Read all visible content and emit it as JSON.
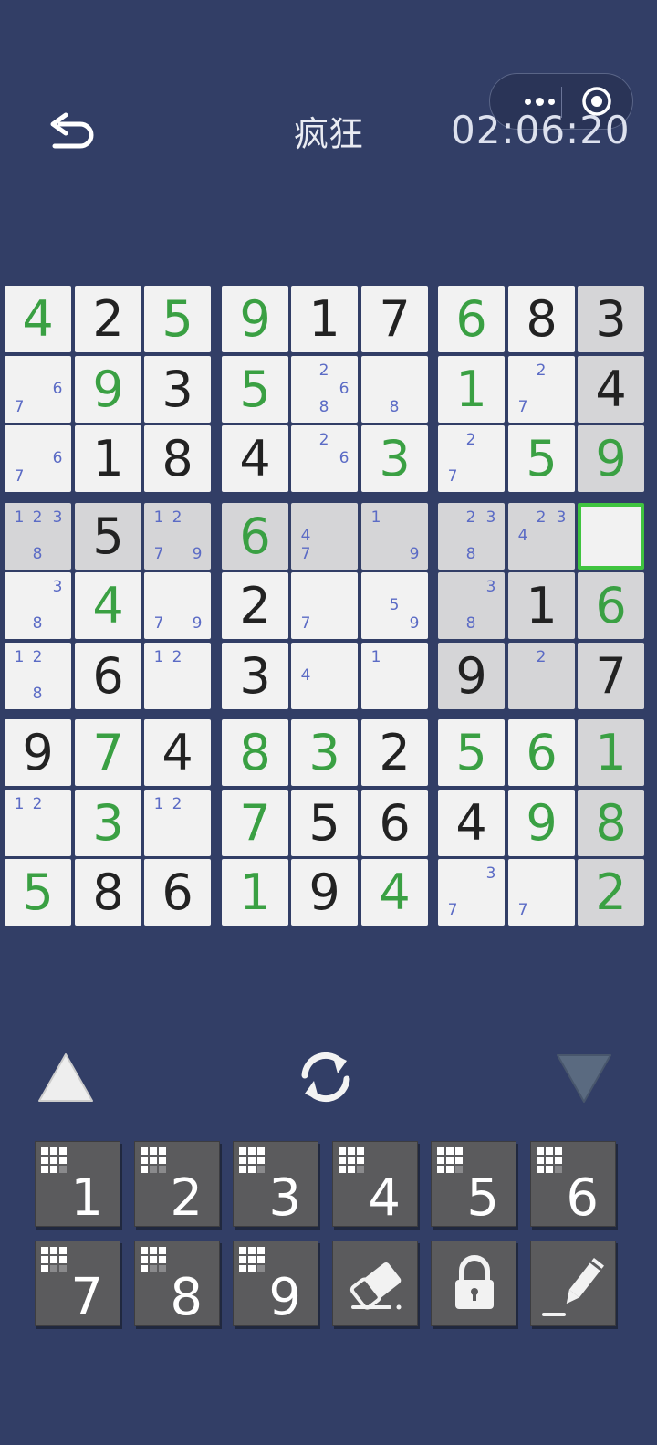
{
  "header": {
    "title": "疯狂",
    "timer": "02:06:20"
  },
  "colors": {
    "background": "#323e66",
    "cell": "#f2f2f2",
    "highlight": "#d5d5d7",
    "given_digit": "#222222",
    "user_digit": "#3aa043",
    "note_digit": "#5b6bc5",
    "selection_border": "#3fc43f",
    "key": "#5b5b5d"
  },
  "board": {
    "selected": {
      "row": 3,
      "col": 8
    },
    "highlighted": [
      [
        0,
        8
      ],
      [
        1,
        8
      ],
      [
        2,
        8
      ],
      [
        3,
        0
      ],
      [
        3,
        1
      ],
      [
        3,
        2
      ],
      [
        3,
        3
      ],
      [
        3,
        4
      ],
      [
        3,
        5
      ],
      [
        3,
        6
      ],
      [
        3,
        7
      ],
      [
        4,
        6
      ],
      [
        4,
        7
      ],
      [
        4,
        8
      ],
      [
        5,
        6
      ],
      [
        5,
        7
      ],
      [
        5,
        8
      ],
      [
        6,
        8
      ],
      [
        7,
        8
      ],
      [
        8,
        8
      ]
    ],
    "values": [
      [
        {
          "v": "4",
          "t": "user"
        },
        {
          "v": "2",
          "t": "given"
        },
        {
          "v": "5",
          "t": "user"
        },
        {
          "v": "9",
          "t": "user"
        },
        {
          "v": "1",
          "t": "given"
        },
        {
          "v": "7",
          "t": "given"
        },
        {
          "v": "6",
          "t": "user"
        },
        {
          "v": "8",
          "t": "given"
        },
        {
          "v": "3",
          "t": "given"
        }
      ],
      [
        null,
        {
          "v": "9",
          "t": "user"
        },
        {
          "v": "3",
          "t": "given"
        },
        {
          "v": "5",
          "t": "user"
        },
        null,
        null,
        {
          "v": "1",
          "t": "user"
        },
        null,
        {
          "v": "4",
          "t": "given"
        }
      ],
      [
        null,
        {
          "v": "1",
          "t": "given"
        },
        {
          "v": "8",
          "t": "given"
        },
        {
          "v": "4",
          "t": "given"
        },
        null,
        {
          "v": "3",
          "t": "user"
        },
        null,
        {
          "v": "5",
          "t": "user"
        },
        {
          "v": "9",
          "t": "user"
        }
      ],
      [
        null,
        {
          "v": "5",
          "t": "given"
        },
        null,
        {
          "v": "6",
          "t": "user"
        },
        null,
        null,
        null,
        null,
        null
      ],
      [
        null,
        {
          "v": "4",
          "t": "user"
        },
        null,
        {
          "v": "2",
          "t": "given"
        },
        null,
        null,
        null,
        {
          "v": "1",
          "t": "given"
        },
        {
          "v": "6",
          "t": "user"
        }
      ],
      [
        null,
        {
          "v": "6",
          "t": "given"
        },
        null,
        {
          "v": "3",
          "t": "given"
        },
        null,
        null,
        {
          "v": "9",
          "t": "given"
        },
        null,
        {
          "v": "7",
          "t": "given"
        }
      ],
      [
        {
          "v": "9",
          "t": "given"
        },
        {
          "v": "7",
          "t": "user"
        },
        {
          "v": "4",
          "t": "given"
        },
        {
          "v": "8",
          "t": "user"
        },
        {
          "v": "3",
          "t": "user"
        },
        {
          "v": "2",
          "t": "given"
        },
        {
          "v": "5",
          "t": "user"
        },
        {
          "v": "6",
          "t": "user"
        },
        {
          "v": "1",
          "t": "user"
        }
      ],
      [
        null,
        {
          "v": "3",
          "t": "user"
        },
        null,
        {
          "v": "7",
          "t": "user"
        },
        {
          "v": "5",
          "t": "given"
        },
        {
          "v": "6",
          "t": "given"
        },
        {
          "v": "4",
          "t": "given"
        },
        {
          "v": "9",
          "t": "user"
        },
        {
          "v": "8",
          "t": "user"
        }
      ],
      [
        {
          "v": "5",
          "t": "user"
        },
        {
          "v": "8",
          "t": "given"
        },
        {
          "v": "6",
          "t": "given"
        },
        {
          "v": "1",
          "t": "user"
        },
        {
          "v": "9",
          "t": "given"
        },
        {
          "v": "4",
          "t": "user"
        },
        null,
        null,
        {
          "v": "2",
          "t": "user"
        }
      ]
    ],
    "notes": {
      "1,0": [
        "6",
        "7"
      ],
      "1,4": [
        "2",
        "6",
        "8"
      ],
      "1,5": [
        "8"
      ],
      "1,7": [
        "2",
        "7"
      ],
      "2,0": [
        "6",
        "7"
      ],
      "2,4": [
        "2",
        "6"
      ],
      "2,6": [
        "2",
        "7"
      ],
      "3,0": [
        "1",
        "2",
        "3",
        "8"
      ],
      "3,2": [
        "1",
        "2",
        "7",
        "9"
      ],
      "3,4": [
        "4",
        "7"
      ],
      "3,5": [
        "1",
        "9"
      ],
      "3,6": [
        "2",
        "3",
        "8"
      ],
      "3,7": [
        "2",
        "3",
        "4"
      ],
      "4,0": [
        "3",
        "8"
      ],
      "4,2": [
        "7",
        "9"
      ],
      "4,4": [
        "7"
      ],
      "4,5": [
        "5",
        "9"
      ],
      "4,6": [
        "3",
        "8"
      ],
      "5,0": [
        "1",
        "2",
        "8"
      ],
      "5,2": [
        "1",
        "2"
      ],
      "5,4": [
        "4"
      ],
      "5,5": [
        "1"
      ],
      "5,7": [
        "2"
      ],
      "7,0": [
        "1",
        "2"
      ],
      "7,2": [
        "1",
        "2"
      ],
      "8,6": [
        "3",
        "7"
      ],
      "8,7": [
        "7"
      ]
    }
  },
  "toolbar": {
    "left": "triangle-up-icon",
    "center": "refresh-icon",
    "right": "triangle-down-icon"
  },
  "keypad": {
    "digits": [
      "1",
      "2",
      "3",
      "4",
      "5",
      "6",
      "7",
      "8",
      "9"
    ],
    "remaining": [
      8,
      7,
      8,
      8,
      8,
      8,
      7,
      7,
      8
    ],
    "tools": [
      "eraser-icon",
      "lock-icon",
      "pencil-icon"
    ]
  }
}
